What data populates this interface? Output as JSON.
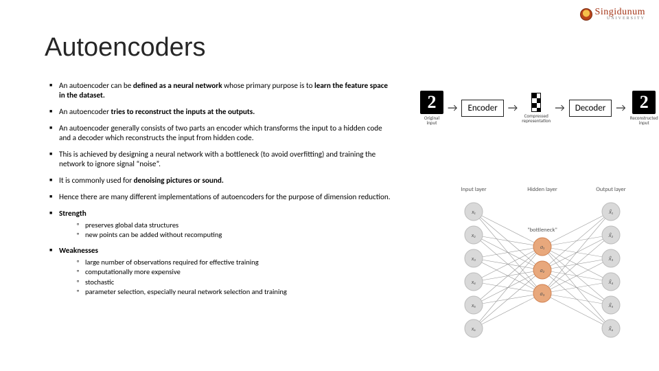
{
  "logo": {
    "name": "Singidunum",
    "sub": "UNIVERSITY"
  },
  "title": "Autoencoders",
  "bullets": [
    {
      "html": "An autoencoder can be <b>defined as a neural network</b> whose primary purpose is to <b>learn the feature space in the dataset.</b>"
    },
    {
      "html": "An autoencoder <b>tries to reconstruct the inputs at the outputs.</b>"
    },
    {
      "html": "An autoencoder generally consists of two parts an encoder which transforms the input to a hidden code and a decoder which reconstructs the input from hidden code."
    },
    {
      "html": "This is achieved by designing a neural network with a bottleneck (to avoid overfitting) and training the network to ignore signal “noise”."
    },
    {
      "html": "It is commonly used for <b>denoising pictures or sound.</b>"
    },
    {
      "html": "Hence there are many different implementations of autoencoders for the purpose of dimension reduction."
    },
    {
      "html": "<b>Strength</b>",
      "sub": [
        "preserves global data structures",
        "new points can be added without recomputing"
      ]
    },
    {
      "html": "<b>Weaknesses</b>",
      "sub": [
        "large number of observations required for effective training",
        "computationally more expensive",
        "stochastic",
        "parameter selection, especially neural network selection and training"
      ]
    }
  ],
  "fig1": {
    "original_caption": "Original input",
    "encoder": "Encoder",
    "compressed_caption": "Compressed representation",
    "decoder": "Decoder",
    "reconstructed_caption": "Reconstructed input",
    "digit": "2"
  },
  "fig2": {
    "input_label": "Input layer",
    "hidden_label": "Hidden layer",
    "output_label": "Output layer",
    "bottleneck_label": "\"bottleneck\"",
    "inputs": [
      "x₁",
      "x₂",
      "x₃",
      "x₄",
      "x₅",
      "x₆"
    ],
    "hidden": [
      "a₁",
      "a₂",
      "a₃"
    ],
    "outputs": [
      "x̂₁",
      "x̂₂",
      "x̂₃",
      "x̂₄",
      "x̂₅",
      "x̂₆"
    ]
  }
}
